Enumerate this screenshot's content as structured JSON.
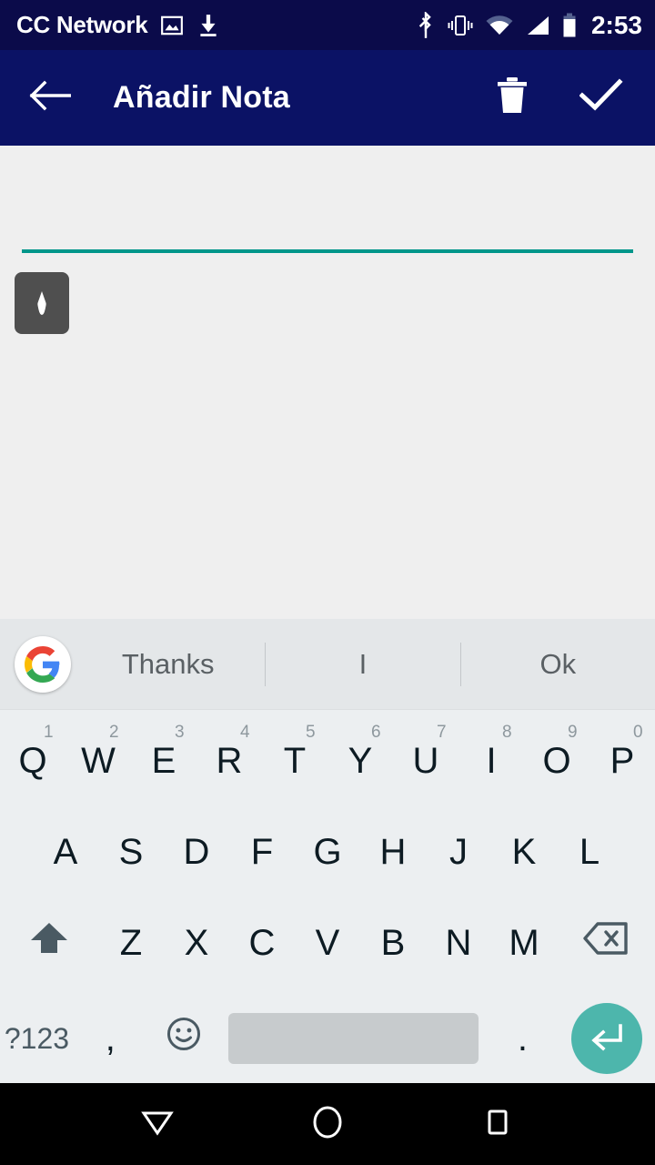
{
  "status_bar": {
    "carrier": "CC Network",
    "time": "2:53",
    "icons": [
      "image-icon",
      "download-icon",
      "bluetooth-icon",
      "vibrate-icon",
      "wifi-icon",
      "cellular-signal-icon",
      "battery-icon"
    ],
    "background_color": "#0b0b4a"
  },
  "app_bar": {
    "title": "Añadir Nota",
    "back_icon": "back-arrow-icon",
    "delete_icon": "trash-icon",
    "save_icon": "check-icon",
    "background_color": "#0b1265"
  },
  "content": {
    "note_value": "",
    "note_placeholder": "",
    "underline_color": "#00968a",
    "background_color": "#efefef",
    "cursor_handle_icon": "text-cursor-handle-icon"
  },
  "keyboard": {
    "logo_icon": "google-g-icon",
    "suggestions": [
      "Thanks",
      "I",
      "Ok"
    ],
    "row1": [
      {
        "letter": "Q",
        "num": "1"
      },
      {
        "letter": "W",
        "num": "2"
      },
      {
        "letter": "E",
        "num": "3"
      },
      {
        "letter": "R",
        "num": "4"
      },
      {
        "letter": "T",
        "num": "5"
      },
      {
        "letter": "Y",
        "num": "6"
      },
      {
        "letter": "U",
        "num": "7"
      },
      {
        "letter": "I",
        "num": "8"
      },
      {
        "letter": "O",
        "num": "9"
      },
      {
        "letter": "P",
        "num": "0"
      }
    ],
    "row2": [
      "A",
      "S",
      "D",
      "F",
      "G",
      "H",
      "J",
      "K",
      "L"
    ],
    "row3": [
      "Z",
      "X",
      "C",
      "V",
      "B",
      "N",
      "M"
    ],
    "shift_icon": "shift-up-arrow-icon",
    "backspace_icon": "backspace-icon",
    "symbols_label": "?123",
    "comma_label": ",",
    "emoji_icon": "emoji-smiley-icon",
    "period_label": ".",
    "enter_icon": "enter-return-icon",
    "enter_color": "#4db6ac",
    "background_color": "#eceff1",
    "suggestion_strip_color": "#e4e7e9",
    "spacebar_color": "#c7cbcd"
  },
  "nav_bar": {
    "back_icon": "nav-back-triangle-icon",
    "home_icon": "nav-home-circle-icon",
    "recents_icon": "nav-recents-square-icon",
    "background_color": "#000000"
  }
}
